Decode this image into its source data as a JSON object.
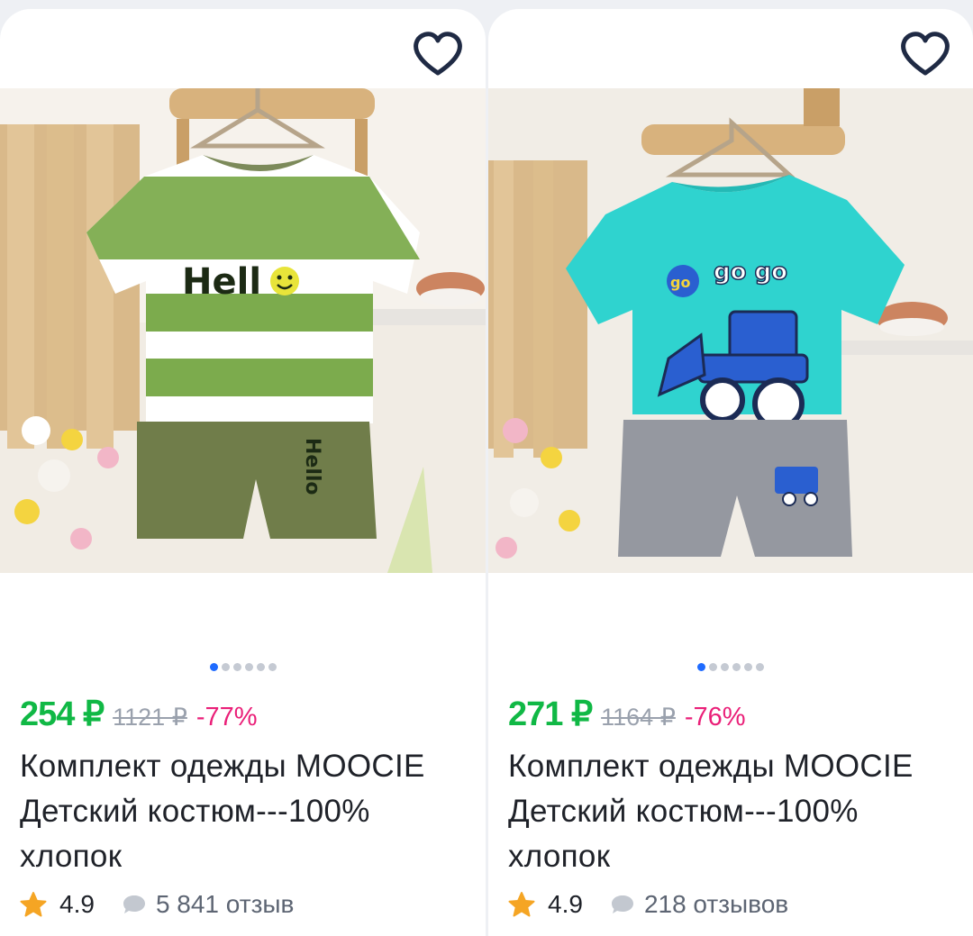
{
  "products": [
    {
      "price": "254 ₽",
      "old_price": "1121 ₽",
      "discount": "-77%",
      "title": "Комплект одежды MOOCIE Детский костюм---100% хлопок",
      "rating": "4.9",
      "reviews": "5 841 отзыв",
      "image": {
        "tshirt_print": "Hello",
        "shorts_print": "Hello"
      },
      "carousel": {
        "total": 6,
        "active": 1
      }
    },
    {
      "price": "271 ₽",
      "old_price": "1164 ₽",
      "discount": "-76%",
      "title": "Комплект одежды MOOCIE Детский костюм---100% хлопок",
      "rating": "4.9",
      "reviews": "218 отзывов",
      "image": {
        "tshirt_print": "go go go"
      },
      "carousel": {
        "total": 6,
        "active": 1
      }
    }
  ],
  "icons": {
    "favorite": "heart-outline-icon",
    "rating": "star-icon",
    "reviews": "chat-bubble-icon"
  },
  "colors": {
    "price": "#10b845",
    "discount": "#ea1f78",
    "old_price": "#9aa1ad",
    "active_dot": "#1f6bff",
    "star": "#f5a524"
  }
}
